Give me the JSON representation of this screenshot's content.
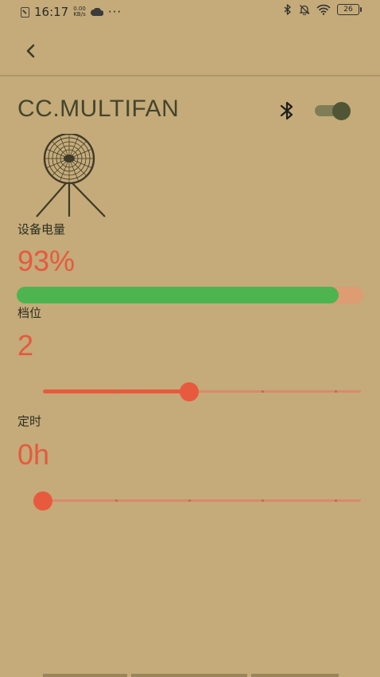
{
  "status_bar": {
    "time": "16:17",
    "speed_value": "0.00",
    "speed_unit": "KB/s",
    "more": "···",
    "battery_level": "26"
  },
  "device": {
    "name": "CC.MULTIFAN",
    "bluetooth_enabled": true
  },
  "battery": {
    "label": "设备电量",
    "value": "93%",
    "percent": 93
  },
  "gear": {
    "label": "档位",
    "value": "2",
    "level": 2,
    "max": 4
  },
  "timer": {
    "label": "定时",
    "value": "0h",
    "level": 0,
    "max": 4
  },
  "colors": {
    "background": "#c4ab79",
    "accent": "#e55a3f",
    "battery_fill": "#4db450",
    "battery_track": "#dd9c72",
    "title_text": "#45452e"
  }
}
